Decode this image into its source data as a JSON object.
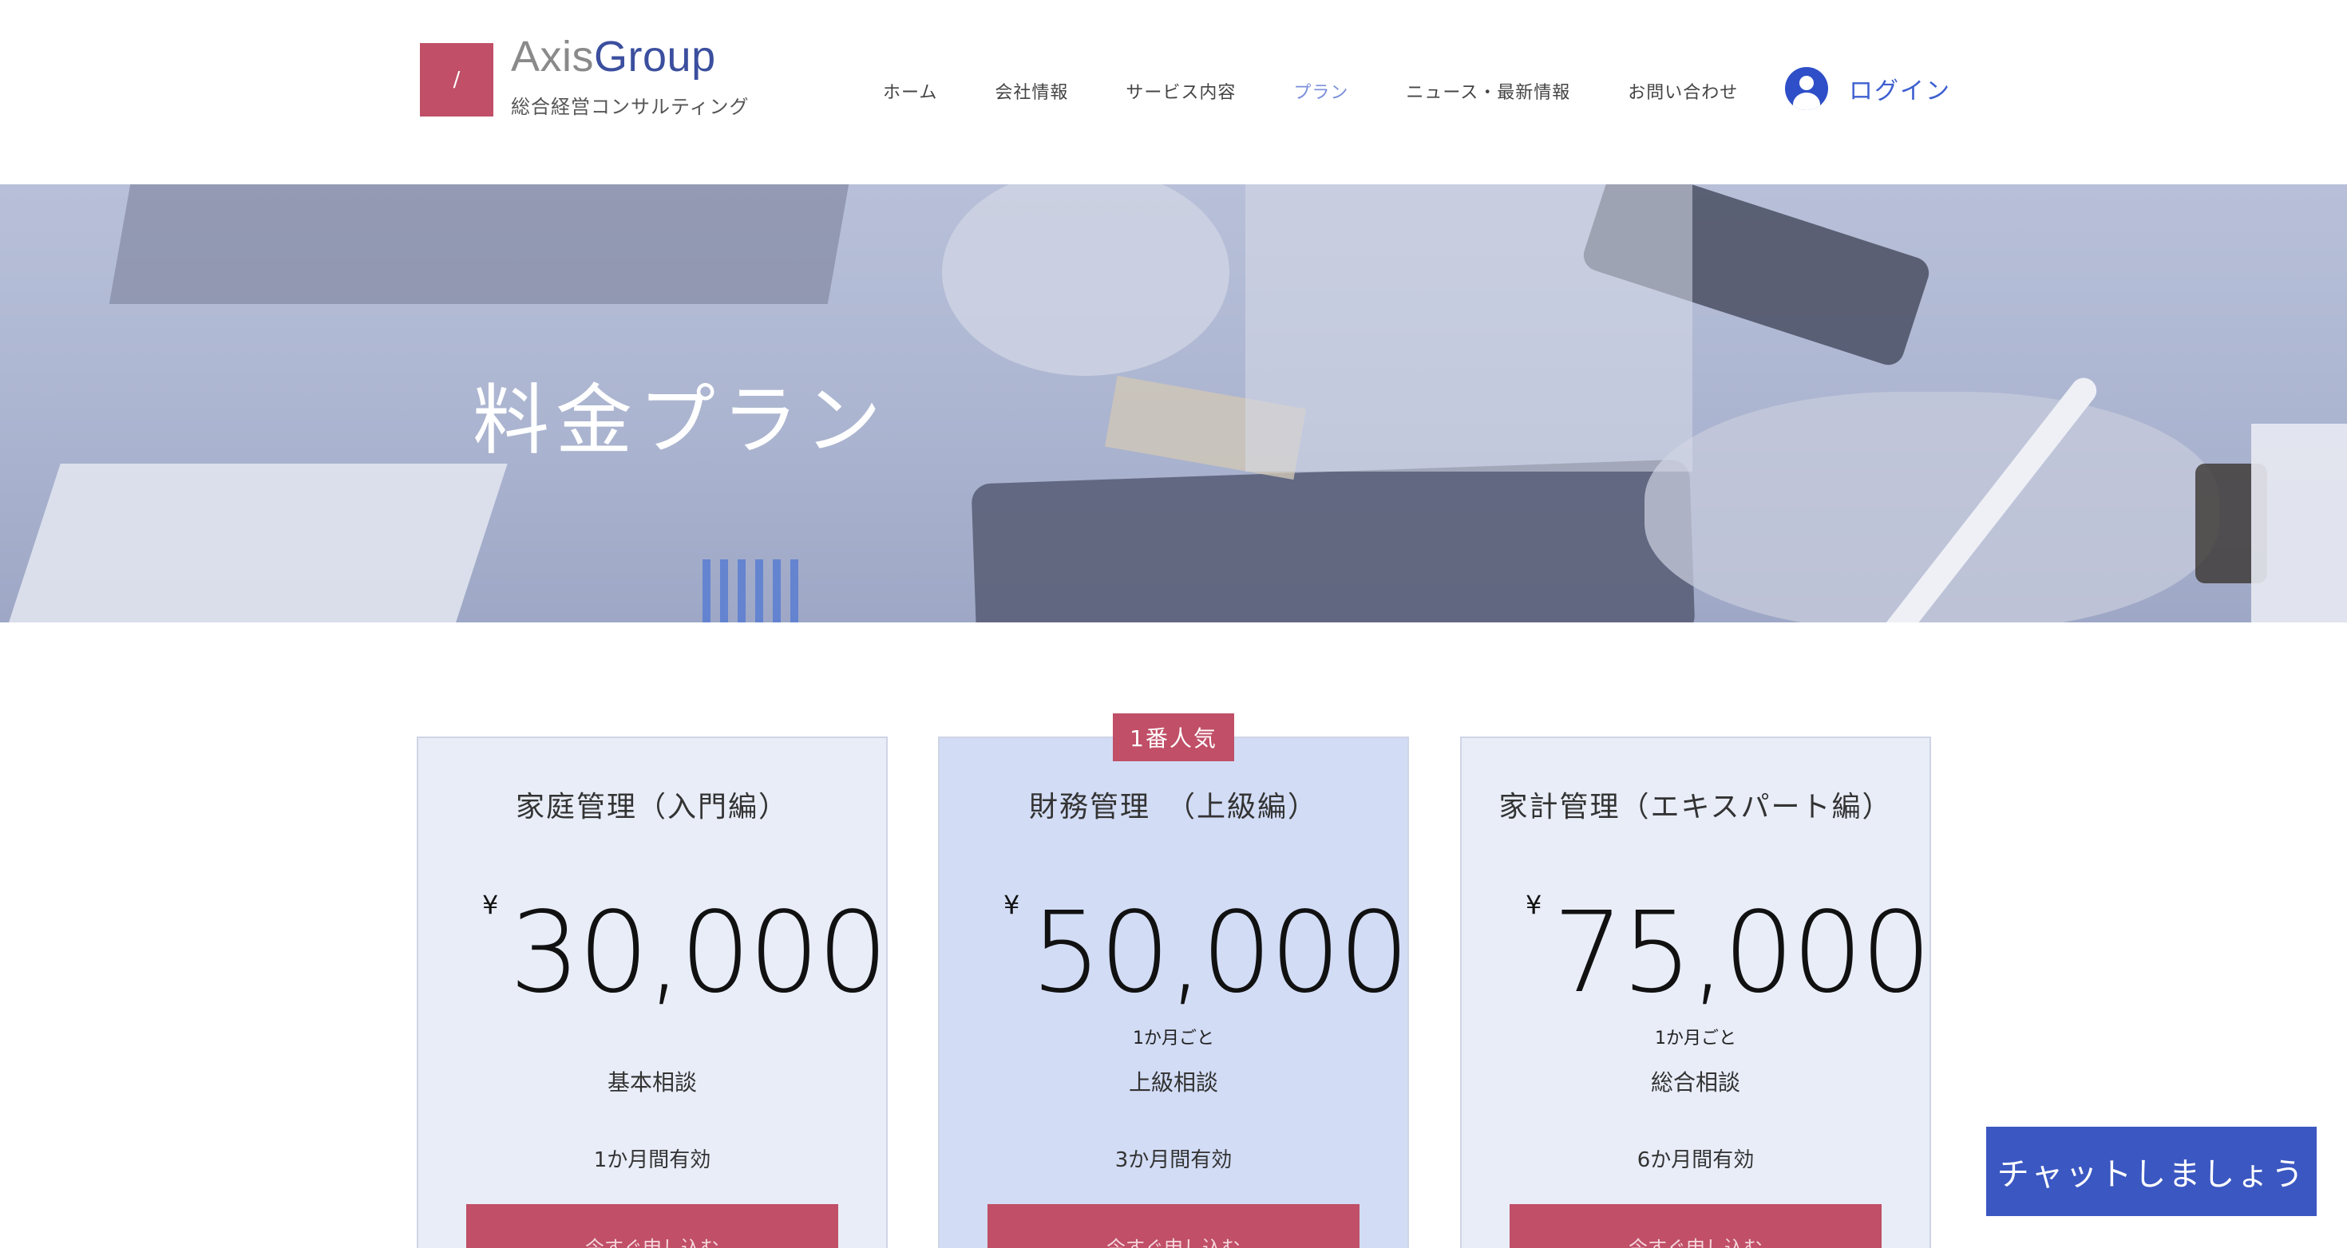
{
  "header": {
    "logo_mark": "/",
    "brand_part1": "Axis",
    "brand_part2": "Group",
    "tagline": "総合経営コンサルティング",
    "nav": [
      {
        "label": "ホーム"
      },
      {
        "label": "会社情報"
      },
      {
        "label": "サービス内容"
      },
      {
        "label": "プラン",
        "active": true
      },
      {
        "label": "ニュース・最新情報"
      },
      {
        "label": "お問い合わせ"
      }
    ],
    "login_label": "ログイン",
    "login_icon": "user-avatar-icon"
  },
  "hero": {
    "title": "料金プラン"
  },
  "plans": [
    {
      "name": "家庭管理（入門編）",
      "currency": "¥",
      "price": "30,000",
      "period": "",
      "feature": "基本相談",
      "validity": "1か月間有効",
      "cta": "今すぐ申し込む"
    },
    {
      "badge": "1番人気",
      "name": "財務管理　（上級編）",
      "currency": "¥",
      "price": "50,000",
      "period": "1か月ごと",
      "feature": "上級相談",
      "validity": "3か月間有効",
      "cta": "今すぐ申し込む"
    },
    {
      "name": "家計管理（エキスパート編）",
      "currency": "¥",
      "price": "75,000",
      "period": "1か月ごと",
      "feature": "総合相談",
      "validity": "6か月間有効",
      "cta": "今すぐ申し込む"
    }
  ],
  "chat": {
    "label": "チャットしましょう"
  },
  "colors": {
    "accent": "#c04f67",
    "brand_blue": "#3b4f9e",
    "link_blue": "#3d5fd0",
    "chat_bg": "#3b57c1"
  }
}
